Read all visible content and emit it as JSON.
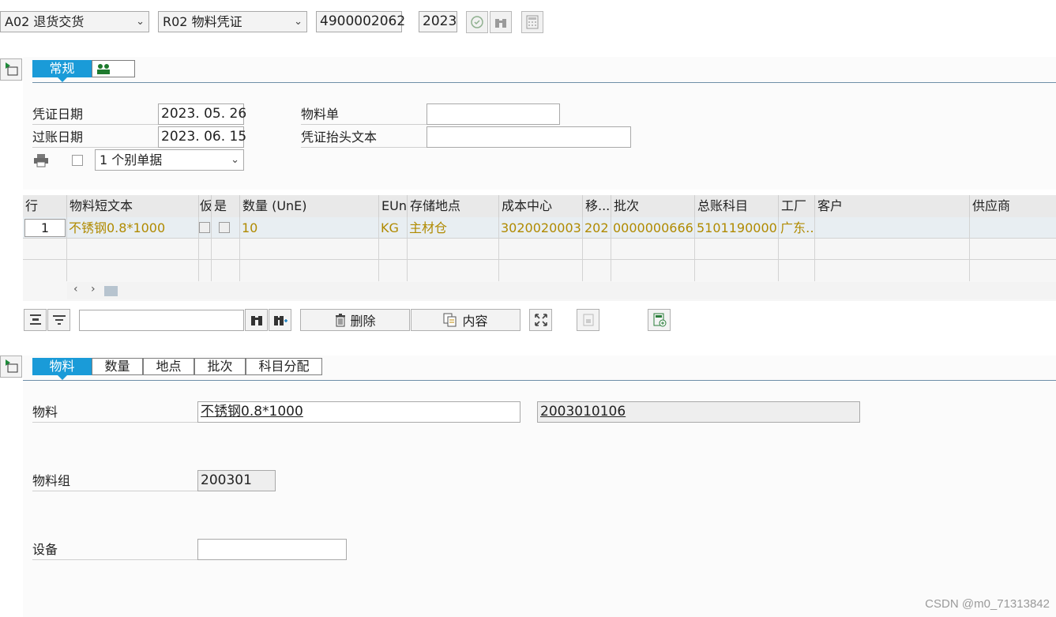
{
  "toolbar": {
    "action": "A02 退货交货",
    "ref_doc_type": "R02 物料凭证",
    "doc_number": "4900002062",
    "doc_year": "2023"
  },
  "header": {
    "tabs": [
      "常规",
      ""
    ],
    "doc_date_label": "凭证日期",
    "doc_date": "2023. 05. 26",
    "posting_date_label": "过账日期",
    "posting_date": "2023. 06. 15",
    "material_slip_label": "物料单",
    "material_slip": "",
    "header_text_label": "凭证抬头文本",
    "header_text": "",
    "print_option": "1 个别单据"
  },
  "grid": {
    "columns": [
      "行",
      "物料短文本",
      "仮",
      "是",
      "数量 (UnE)",
      "EUn",
      "存储地点",
      "成本中心",
      "移...",
      "批次",
      "总账科目",
      "工厂",
      "客户",
      "供应商"
    ],
    "rows": [
      {
        "line": "1",
        "material_text": "不锈钢0.8*1000",
        "quantity": "10",
        "unit": "KG",
        "storage_location": "主材仓",
        "cost_center": "3020020003",
        "movement": "202",
        "batch": "0000000666",
        "gl_account": "5101190000",
        "plant": "广东…",
        "customer": "",
        "vendor": ""
      }
    ]
  },
  "grid_toolbar": {
    "delete_label": "删除",
    "content_label": "内容",
    "search_value": ""
  },
  "detail": {
    "tabs": [
      "物料",
      "数量",
      "地点",
      "批次",
      "科目分配"
    ],
    "material_label": "物料",
    "material_text": "不锈钢0.8*1000",
    "material_number": "2003010106",
    "material_group_label": "物料组",
    "material_group": "200301",
    "equipment_label": "设备",
    "equipment": ""
  },
  "watermark": "CSDN @m0_71313842",
  "colors": {
    "accent": "#1a9bd8",
    "data_text": "#b08a00"
  }
}
